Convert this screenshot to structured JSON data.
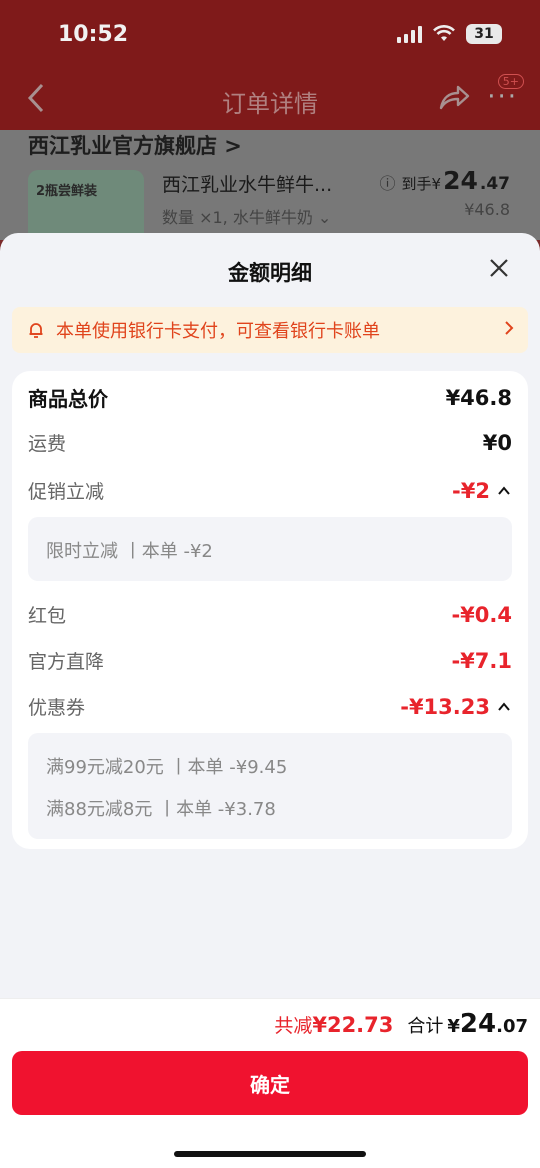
{
  "status_bar": {
    "time": "10:52",
    "battery": "31"
  },
  "nav": {
    "title": "订单详情",
    "badge": "5+"
  },
  "background": {
    "store_name": "西江乳业官方旗舰店 >",
    "product_name": "西江乳业水牛鲜牛...",
    "product_spec": "数量 ×1, 水牛鲜牛奶 ⌄",
    "price_prefix": "到手¥",
    "price_main": "24",
    "price_decimal": ".47",
    "price_original": "¥46.8",
    "thumb_text": "2瓶尝鲜装"
  },
  "sheet": {
    "title": "金额明细",
    "notice": "本单使用银行卡支付，可查看银行卡账单",
    "rows": {
      "goods_total": {
        "label": "商品总价",
        "value": "¥46.8"
      },
      "shipping": {
        "label": "运费",
        "value": "¥0"
      },
      "promo": {
        "label": "促销立减",
        "value": "-¥2"
      },
      "promo_detail": "限时立减  丨本单 -¥2",
      "red_packet": {
        "label": "红包",
        "value": "-¥0.4"
      },
      "official_cut": {
        "label": "官方直降",
        "value": "-¥7.1"
      },
      "coupon": {
        "label": "优惠券",
        "value": "-¥13.23"
      },
      "coupon_detail_1": "满99元减20元  丨本单 -¥9.45",
      "coupon_detail_2": "满88元减8元  丨本单 -¥3.78"
    }
  },
  "bottom": {
    "saved_label": "共减",
    "saved_amount": "¥22.73",
    "total_label": "合计",
    "total_currency": "¥",
    "total_main": "24",
    "total_decimal": ".07",
    "confirm_label": "确定"
  },
  "colors": {
    "accent_red": "#e8242c",
    "button_red": "#f0122f",
    "notice_bg": "#fdf2dd",
    "notice_text": "#e0441c"
  }
}
